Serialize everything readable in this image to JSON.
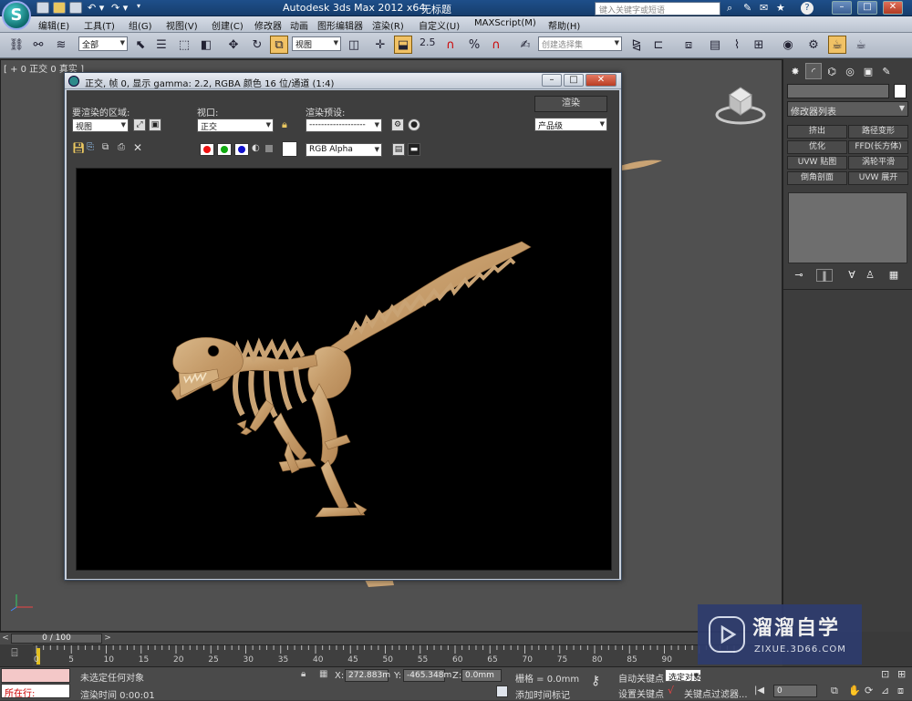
{
  "app": {
    "title": "Autodesk 3ds Max  2012 x64",
    "document": "无标题",
    "logo_letter": "S",
    "search_placeholder": "键入关键字或短语",
    "help_label": "?"
  },
  "menu": [
    "编辑(E)",
    "工具(T)",
    "组(G)",
    "视图(V)",
    "创建(C)",
    "修改器",
    "动画",
    "图形编辑器",
    "渲染(R)",
    "自定义(U)",
    "MAXScript(M)",
    "帮助(H)"
  ],
  "toolbar": {
    "selection_filter": "全部",
    "coord_system": "视图",
    "snap_value": "2.5",
    "named_selection_placeholder": "创建选择集"
  },
  "viewport": {
    "label": "[ + 0 正交 0 真实 ]"
  },
  "render_frame": {
    "title": "正交, 帧 0, 显示 gamma: 2.2, RGBA 颜色 16 位/通道 (1:4)",
    "area_label": "要渲染的区域:",
    "area_value": "视图",
    "viewport_label": "视口:",
    "viewport_value": "正交",
    "preset_label": "渲染预设:",
    "preset_value": "-------------------",
    "render_button": "渲染",
    "quality_value": "产品级",
    "channel_value": "RGB Alpha"
  },
  "command_panel": {
    "modifier_list": "修改器列表",
    "buttons": [
      "挤出",
      "路径变形",
      "优化",
      "FFD(长方体)",
      "UVW 贴图",
      "涡轮平滑",
      "倒角剖面",
      "UVW 展开"
    ]
  },
  "timeline": {
    "frame_display": "0 / 100",
    "ticks": [
      "0",
      "5",
      "10",
      "15",
      "20",
      "25",
      "30",
      "35",
      "40",
      "45",
      "50",
      "55",
      "60",
      "65",
      "70",
      "75",
      "80",
      "85",
      "90"
    ]
  },
  "status": {
    "maxscript_label": "所在行:",
    "selection_msg": "未选定任何对象",
    "render_time": "渲染时间  0:00:01",
    "x_label": "X:",
    "x_value": "272.883m",
    "y_label": "Y:",
    "y_value": "-465.348m",
    "z_label": "Z:",
    "z_value": "0.0mm",
    "grid": "栅格 = 0.0mm",
    "add_time_tag": "添加时间标记",
    "auto_key": "自动关键点",
    "set_key": "设置关键点",
    "selected_dropdown": "选定对象",
    "key_filters": "关键点过滤器...",
    "frame_field": "0"
  },
  "watermark": {
    "cn": "溜溜自学",
    "en": "ZIXUE.3D66.COM"
  },
  "colors": {
    "accent_active": "#f1c265",
    "wood": "#c9a374",
    "watermark_bg": "#2e3c6e"
  }
}
